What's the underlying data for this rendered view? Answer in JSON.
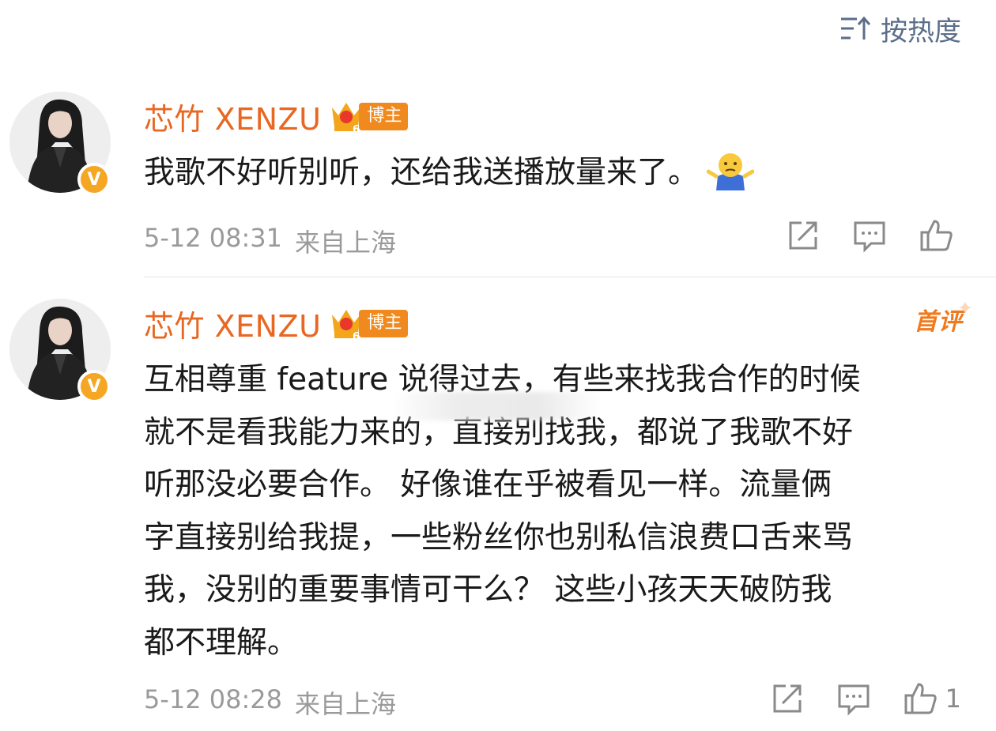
{
  "sort": {
    "label": "按热度",
    "icon": "sort-hot-icon"
  },
  "comments": [
    {
      "username": "芯竹 XENZU",
      "badge_level": "6",
      "badge_tag": "博主",
      "verified_mark": "V",
      "text": "我歌不好听别听，还给我送播放量来了。",
      "emoji": "shrug-emoji-icon",
      "date": "5-12 08:31",
      "location": "来自上海",
      "actions": {
        "repost": "repost-icon",
        "reply": "comment-icon",
        "like": "thumbs-up-icon",
        "like_count": ""
      }
    },
    {
      "username": "芯竹 XENZU",
      "badge_level": "6",
      "badge_tag": "博主",
      "verified_mark": "V",
      "first_label": "首评",
      "text_lines": [
        "互相尊重 feature 说得过去，有些来找我合作的时候",
        "就不是看我能力来的，直接别找我，都说了我歌不好",
        "听那没必要合作。 好像谁在乎被看见一样。流量俩",
        "字直接别给我提，一些粉丝你也别私信浪费口舌来骂",
        "我，没别的重要事情可干么？ 这些小孩天天破防我",
        "都不理解。"
      ],
      "date": "5-12 08:28",
      "location": "来自上海",
      "actions": {
        "repost": "repost-icon",
        "reply": "comment-icon",
        "like": "thumbs-up-icon",
        "like_count": "1"
      }
    }
  ],
  "colors": {
    "username": "#e86722",
    "meta": "#9a9a9a",
    "badge": "#f08a1f",
    "verified": "#f5a623",
    "sort": "#5a6e8a"
  }
}
